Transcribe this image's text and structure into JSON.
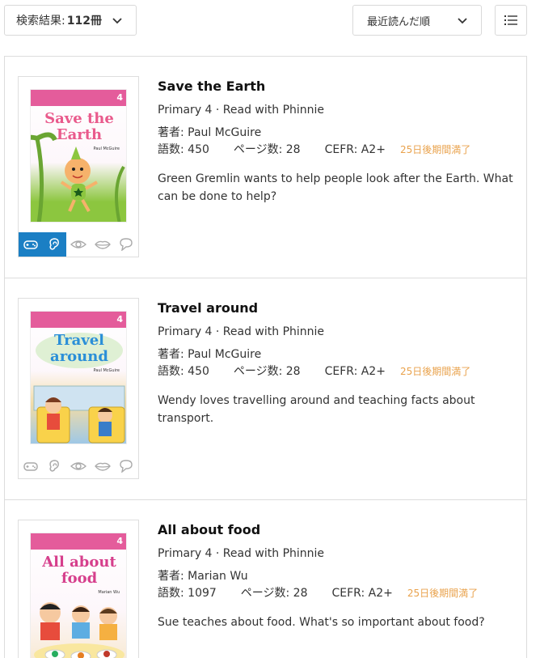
{
  "toolbar": {
    "result_label": "検索結果: ",
    "result_count": "112冊",
    "sort_label": "最近読んだ順"
  },
  "colors": {
    "accent": "#1b7fc4",
    "expiry": "#e9a24c",
    "cover_bar": "#e45c9b"
  },
  "books": [
    {
      "title": "Save the Earth",
      "series": "Primary 4 · Read with Phinnie",
      "author": "著者: Paul McGuire",
      "words": "語数:  450",
      "pages": "ページ数:  28",
      "cefr": "CEFR:  A2+",
      "expiry": "25日後期間満了",
      "description": "Green Gremlin wants to help people look after the Earth. What can be done to help?",
      "cover": {
        "brand": "Read with Phinnie",
        "level": "4",
        "title": "Save the Earth",
        "author": "Paul McGuire"
      },
      "skills": [
        {
          "icon": "gamepad-icon",
          "active": true
        },
        {
          "icon": "ear-icon",
          "active": true
        },
        {
          "icon": "eye-icon",
          "active": false
        },
        {
          "icon": "lips-icon",
          "active": false
        },
        {
          "icon": "speech-bubble-icon",
          "active": false
        }
      ]
    },
    {
      "title": "Travel around",
      "series": "Primary 4 · Read with Phinnie",
      "author": "著者: Paul McGuire",
      "words": "語数:  450",
      "pages": "ページ数:  28",
      "cefr": "CEFR:  A2+",
      "expiry": "25日後期間満了",
      "description": "Wendy loves travelling around and teaching facts about transport.",
      "cover": {
        "brand": "Read with Phinnie",
        "level": "4",
        "title": "Travel around",
        "author": "Paul McGuire"
      },
      "skills": [
        {
          "icon": "gamepad-icon",
          "active": false
        },
        {
          "icon": "ear-icon",
          "active": false
        },
        {
          "icon": "eye-icon",
          "active": false
        },
        {
          "icon": "lips-icon",
          "active": false
        },
        {
          "icon": "speech-bubble-icon",
          "active": false
        }
      ]
    },
    {
      "title": "All about food",
      "series": "Primary 4 · Read with Phinnie",
      "author": "著者: Marian Wu",
      "words": "語数:  1097",
      "pages": "ページ数:  28",
      "cefr": "CEFR:  A2+",
      "expiry": "25日後期間満了",
      "description": "Sue teaches about food. What's so important about food?",
      "cover": {
        "brand": "Read with Phinnie",
        "level": "4",
        "title": "All about food",
        "author": "Marian Wu"
      },
      "skills": []
    }
  ]
}
